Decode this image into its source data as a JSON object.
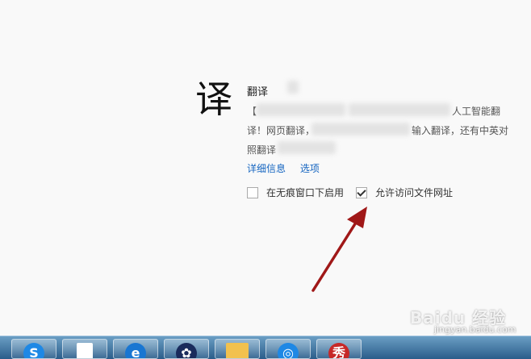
{
  "extension": {
    "icon_glyph": "译",
    "name": "翻译",
    "description_line1": "【",
    "description_frag1": "人工智能翻",
    "description_line2": "译！网页翻译，",
    "description_frag2": "输入翻译，还有中英对",
    "description_line3": "照翻译",
    "details_link": "详细信息",
    "options_link": "选项"
  },
  "options": {
    "incognito_label": "在无痕窗口下启用",
    "incognito_checked": false,
    "file_access_label": "允许访问文件网址",
    "file_access_checked": true
  },
  "annotation": {
    "arrow_color": "#a01818"
  },
  "taskbar": {
    "apps": [
      {
        "name": "sogou-browser",
        "glyph": "S",
        "color": "#1e88e5"
      },
      {
        "name": "document",
        "glyph": "",
        "color": "#ffffff"
      },
      {
        "name": "ie-browser",
        "glyph": "e",
        "color": "#1976d2"
      },
      {
        "name": "paw-app",
        "glyph": "✿",
        "color": "#1a2b5c"
      },
      {
        "name": "folder",
        "glyph": "",
        "color": "#f2c14e"
      },
      {
        "name": "360-browser",
        "glyph": "◎",
        "color": "#1e88e5"
      },
      {
        "name": "show-app",
        "glyph": "秀",
        "color": "#c62828"
      }
    ]
  },
  "watermark": {
    "logo_text": "Baidu 经验",
    "url": "jingyan.baidu.com"
  }
}
